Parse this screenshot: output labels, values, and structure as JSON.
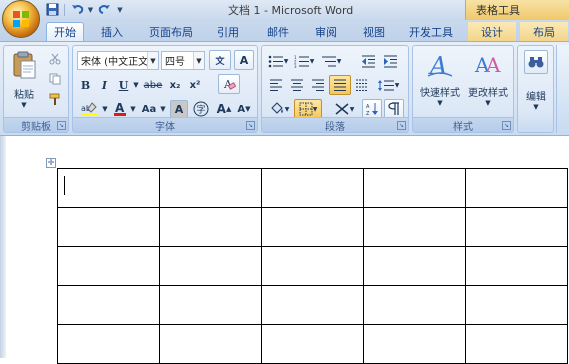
{
  "window": {
    "title": "文档 1 - Microsoft Word",
    "context_tab_group": "表格工具"
  },
  "quick_access": {
    "items": [
      "save-icon",
      "undo-icon",
      "redo-icon",
      "customize-icon"
    ]
  },
  "tabs": [
    {
      "label": "开始",
      "active": true
    },
    {
      "label": "插入"
    },
    {
      "label": "页面布局"
    },
    {
      "label": "引用"
    },
    {
      "label": "邮件"
    },
    {
      "label": "审阅"
    },
    {
      "label": "视图"
    },
    {
      "label": "开发工具"
    },
    {
      "label": "设计"
    },
    {
      "label": "布局"
    }
  ],
  "ribbon": {
    "clipboard": {
      "label": "剪贴板",
      "paste": "粘贴"
    },
    "font": {
      "label": "字体",
      "font_name": "宋体 (中文正文",
      "font_size": "四号",
      "bold": "B",
      "italic": "I",
      "underline": "U",
      "strike": "abe",
      "subscript": "x₂",
      "superscript": "x²",
      "change_case": "Aa",
      "char_border": "A",
      "grow": "A",
      "shrink": "A",
      "clear_format": "A",
      "phonetic": "文",
      "enclose": "字"
    },
    "paragraph": {
      "label": "段落"
    },
    "styles": {
      "label": "样式",
      "quick_styles": "快速样式",
      "change_styles": "更改样式"
    },
    "editing": {
      "label": "编辑"
    }
  },
  "colors": {
    "accent": "#15428b",
    "ribbon_bg": "#d8e5f5",
    "context_tab": "#f3d58a"
  }
}
